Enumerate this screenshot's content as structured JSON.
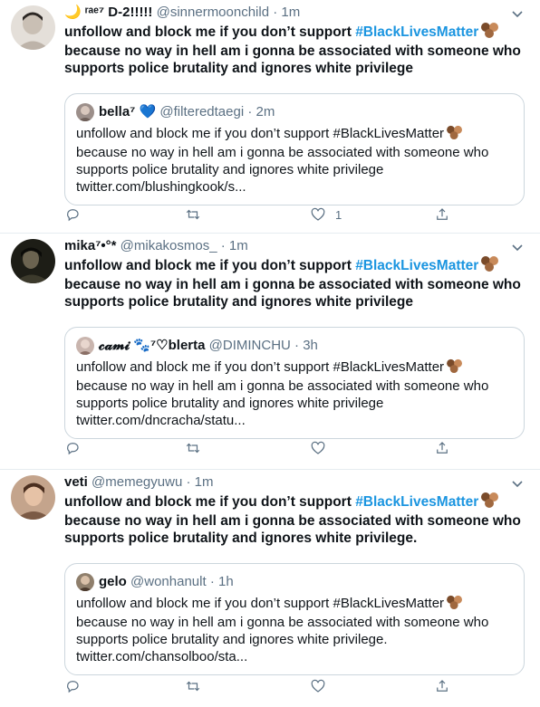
{
  "tweets": [
    {
      "name": "🌙 ʳᵃᵉ⁷ D-2!!!!!",
      "handle": "@sinnermoonchild",
      "dot": "·",
      "time": "1m",
      "body_pre": "unfollow and block me if you don’t support ",
      "hashtag": "#BlackLivesMatter",
      "body_post": "because no way in hell am i gonna be associated with someone who supports police brutality and ignores white privilege",
      "quote": {
        "name": "bella⁷ 💙",
        "handle": "@filteredtaegi",
        "dot": "·",
        "time": "2m",
        "text_pre": "unfollow and block me if you don’t support #BlackLivesMatter",
        "text_post": "because no way in hell am i gonna be associated with someone who supports police brutality and ignores white privilege",
        "link": "twitter.com/blushingkook/s..."
      },
      "likes": "1",
      "avatar_color": "#d8d2cc"
    },
    {
      "name": "mika⁷•°*",
      "handle": "@mikakosmos_",
      "dot": "·",
      "time": "1m",
      "body_pre": "unfollow and block me if you don’t support ",
      "hashtag": "#BlackLivesMatter",
      "body_post": "because no way in hell am i gonna be associated with someone who supports police brutality and ignores white privilege",
      "quote": {
        "name": "𝓬𝓪𝓶𝓲 🐾⁷♡blerta",
        "handle": "@DIMINCHU",
        "dot": "·",
        "time": "3h",
        "text_pre": "unfollow and block me if you don’t support #BlackLivesMatter",
        "text_post": "because no way in hell am i gonna be associated with someone who supports police brutality and ignores white privilege",
        "link": "twitter.com/dncracha/statu..."
      },
      "likes": "",
      "avatar_color": "#3a3a2e"
    },
    {
      "name": "veti",
      "handle": "@memegyuwu",
      "dot": "·",
      "time": "1m",
      "body_pre": "unfollow and block me if you don’t support ",
      "hashtag": "#BlackLivesMatter",
      "body_post": "because no way in hell am i gonna be associated with someone who supports police brutality and ignores white privilege.",
      "quote": {
        "name": "gelo",
        "handle": "@wonhanult",
        "dot": "·",
        "time": "1h",
        "text_pre": "unfollow and block me if you don’t support #BlackLivesMatter",
        "text_post": "because no way in hell am i gonna be associated with someone who supports police brutality and ignores white privilege.",
        "link": "twitter.com/chansolboo/sta..."
      },
      "likes": "",
      "avatar_color": "#a87a5e"
    }
  ],
  "icons": {
    "reply": "reply-icon",
    "retweet": "retweet-icon",
    "like": "heart-icon",
    "share": "share-icon",
    "caret": "chevron-down-icon",
    "hands": "raised-hands-emoji"
  },
  "colors": {
    "hashtag": "#1b95e0",
    "meta": "#5b7083",
    "border": "#ccd6dd"
  }
}
